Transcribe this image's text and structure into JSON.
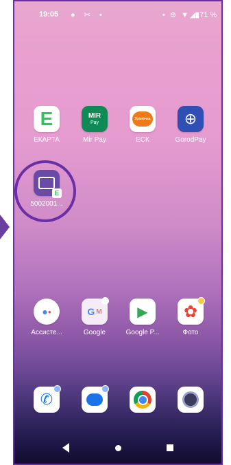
{
  "status": {
    "time": "19:05",
    "left_icons": "● ✂ •",
    "right_icons": "• ⊕ ▼◢",
    "battery": "▮71 %"
  },
  "apps_row1": [
    {
      "label": "ЕКАРТА",
      "icon": "ekarta-icon",
      "glyph": "E",
      "bg": "#ffffff",
      "fg": "#2ec55d"
    },
    {
      "label": "Mir Pay",
      "icon": "mirpay-icon",
      "glyph": "MIR",
      "sub": "Pay",
      "bg": "#0f8a55",
      "fg": "#ffffff"
    },
    {
      "label": "ЕСК",
      "icon": "esk-icon",
      "glyph": "Уралочка",
      "bg": "#ffffff",
      "fg": "#f07a1a"
    },
    {
      "label": "GorodPay",
      "icon": "gorodpay-icon",
      "glyph": "⊕",
      "bg": "#2f4fb5",
      "fg": "#ffffff"
    }
  ],
  "apps_row2": [
    {
      "label": "5002001...",
      "icon": "shortcut-card-icon",
      "glyph": "▭",
      "badge": "E",
      "bg": "#6a4aa7",
      "fg": "#ffffff"
    }
  ],
  "apps_row3": [
    {
      "label": "Ассисте...",
      "icon": "assistant-icon",
      "glyph": "●",
      "bg": "#ffffff",
      "fg": "#4285f4"
    },
    {
      "label": "Google",
      "icon": "google-folder-icon",
      "glyph": "G",
      "bg": "#f6ecf8",
      "fg": "#4285f4"
    },
    {
      "label": "Google P...",
      "icon": "google-play-icon",
      "glyph": "▶",
      "bg": "#ffffff",
      "fg": "#34a853"
    },
    {
      "label": "Фото",
      "icon": "photos-icon",
      "glyph": "✿",
      "bg": "#ffffff",
      "fg": "#ea4335"
    }
  ],
  "dock": [
    {
      "icon": "phone-icon",
      "glyph": "✆",
      "bg": "#ffffff",
      "fg": "#1a73e8"
    },
    {
      "icon": "messages-icon",
      "glyph": "▬",
      "bg": "#ffffff",
      "fg": "#1a73e8"
    },
    {
      "icon": "chrome-icon",
      "glyph": "◉",
      "bg": "#ffffff",
      "fg": "#db4437"
    },
    {
      "icon": "camera-icon",
      "glyph": "◎",
      "bg": "#ffffff",
      "fg": "#3b3b5e"
    }
  ],
  "accent": "#6a2fa5"
}
